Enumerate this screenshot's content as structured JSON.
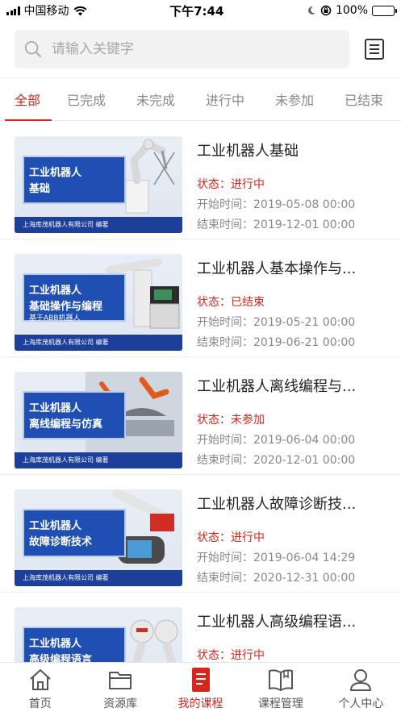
{
  "status_bar": {
    "carrier": "中国移动",
    "time": "下午7:44",
    "battery": "100%"
  },
  "search": {
    "placeholder": "请输入关键字"
  },
  "tabs": [
    {
      "label": "全部"
    },
    {
      "label": "已完成"
    },
    {
      "label": "未完成"
    },
    {
      "label": "进行中"
    },
    {
      "label": "未参加"
    },
    {
      "label": "已结束"
    }
  ],
  "courses": [
    {
      "title": "工业机器人基础",
      "state": "状态：进行中",
      "start": "开始时间：2019-05-08 00:00",
      "end": "结束时间：2019-12-01 00:00",
      "cover": {
        "line1": "工业机器人",
        "line2": "基础",
        "line3": "",
        "footer": "上海库茂机器人有限公司 编著"
      }
    },
    {
      "title": "工业机器人基本操作与...",
      "state": "状态：已结束",
      "start": "开始时间：2019-05-21 00:00",
      "end": "结束时间：2019-06-21 00:00",
      "cover": {
        "line1": "工业机器人",
        "line2": "基础操作与编程",
        "line3": "基于ABB机器人",
        "footer": "上海库茂机器人有限公司 编著"
      }
    },
    {
      "title": "工业机器人离线编程与...",
      "state": "状态：未参加",
      "start": "开始时间：2019-06-04 00:00",
      "end": "结束时间：2020-12-01 00:00",
      "cover": {
        "line1": "工业机器人",
        "line2": "离线编程与仿真",
        "line3": "",
        "footer": "上海库茂机器人有限公司 编著"
      }
    },
    {
      "title": "工业机器人故障诊断技...",
      "state": "状态：进行中",
      "start": "开始时间：2019-06-04 14:29",
      "end": "结束时间：2020-12-31 00:00",
      "cover": {
        "line1": "工业机器人",
        "line2": "故障诊断技术",
        "line3": "",
        "footer": "上海库茂机器人有限公司 编著"
      }
    },
    {
      "title": "工业机器人高级编程语...",
      "state": "状态：进行中",
      "start": "",
      "end": "",
      "cover": {
        "line1": "工业机器人",
        "line2": "高级编程语言",
        "line3": "",
        "footer": ""
      }
    }
  ],
  "bottom_nav": [
    {
      "label": "首页",
      "icon": "home-icon"
    },
    {
      "label": "资源库",
      "icon": "folder-icon"
    },
    {
      "label": "我的课程",
      "icon": "course-book-icon"
    },
    {
      "label": "课程管理",
      "icon": "open-book-icon"
    },
    {
      "label": "个人中心",
      "icon": "user-icon"
    }
  ],
  "colors": {
    "accent": "#d9261c",
    "tab_inactive": "#888888",
    "battery": "#31c24a"
  }
}
